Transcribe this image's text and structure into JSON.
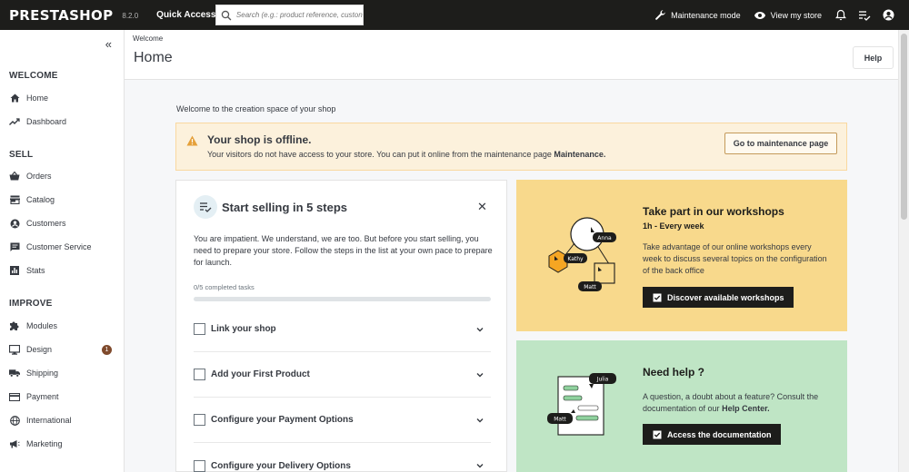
{
  "topbar": {
    "logo": "PRESTASHOP",
    "version": "8.2.0",
    "quick_access": "Quick Access",
    "search_placeholder": "Search (e.g.: product reference, custon",
    "maintenance_mode": "Maintenance mode",
    "view_store": "View my store"
  },
  "sidebar": {
    "sections": [
      {
        "title": "WELCOME",
        "items": [
          {
            "label": "Home",
            "icon": "home-icon"
          },
          {
            "label": "Dashboard",
            "icon": "trending-up-icon"
          }
        ]
      },
      {
        "title": "SELL",
        "items": [
          {
            "label": "Orders",
            "icon": "basket-icon"
          },
          {
            "label": "Catalog",
            "icon": "store-icon"
          },
          {
            "label": "Customers",
            "icon": "account-circle-icon"
          },
          {
            "label": "Customer Service",
            "icon": "chat-icon"
          },
          {
            "label": "Stats",
            "icon": "bar-chart-icon"
          }
        ]
      },
      {
        "title": "IMPROVE",
        "items": [
          {
            "label": "Modules",
            "icon": "puzzle-icon"
          },
          {
            "label": "Design",
            "icon": "desktop-icon",
            "badge": "1"
          },
          {
            "label": "Shipping",
            "icon": "truck-icon"
          },
          {
            "label": "Payment",
            "icon": "credit-card-icon"
          },
          {
            "label": "International",
            "icon": "globe-icon"
          },
          {
            "label": "Marketing",
            "icon": "megaphone-icon"
          }
        ]
      }
    ]
  },
  "header": {
    "breadcrumb": "Welcome",
    "title": "Home",
    "help_label": "Help"
  },
  "main": {
    "welcome_text": "Welcome to the creation space of your shop",
    "alert": {
      "title": "Your shop is offline.",
      "text": "Your visitors do not have access to your store. You can put it online from the maintenance page",
      "text_bold": "Maintenance.",
      "button": "Go to maintenance page"
    },
    "steps": {
      "title": "Start selling in 5 steps",
      "description": "You are impatient. We understand, we are too. But before you start selling, you need to prepare your store. Follow the steps in the list at your own pace to prepare for launch.",
      "progress_label": "0/5 completed tasks",
      "progress_fraction": 0,
      "items": [
        "Link your shop",
        "Add your First Product",
        "Configure your Payment Options",
        "Configure your Delivery Options"
      ]
    },
    "workshop": {
      "title": "Take part in our workshops",
      "subtitle": "1h - Every week",
      "text": "Take advantage of our online workshops every week to discuss several topics on the configuration of the back office",
      "button": "Discover available workshops",
      "illustration_labels": [
        "Anna",
        "Kathy",
        "Matt"
      ]
    },
    "help": {
      "title": "Need help ?",
      "text": "A question, a doubt about a feature? Consult the documentation of our",
      "text_bold": "Help Center.",
      "button": "Access the documentation",
      "illustration_labels": [
        "Julia",
        "Matt"
      ]
    }
  },
  "colors": {
    "topbar": "#1d1d1b",
    "alert_bg": "#fcf1dc",
    "workshop_bg": "#f8d98c",
    "help_bg": "#bfe5c5",
    "progress": "#25b9d7",
    "badge": "#7f4a2c"
  }
}
